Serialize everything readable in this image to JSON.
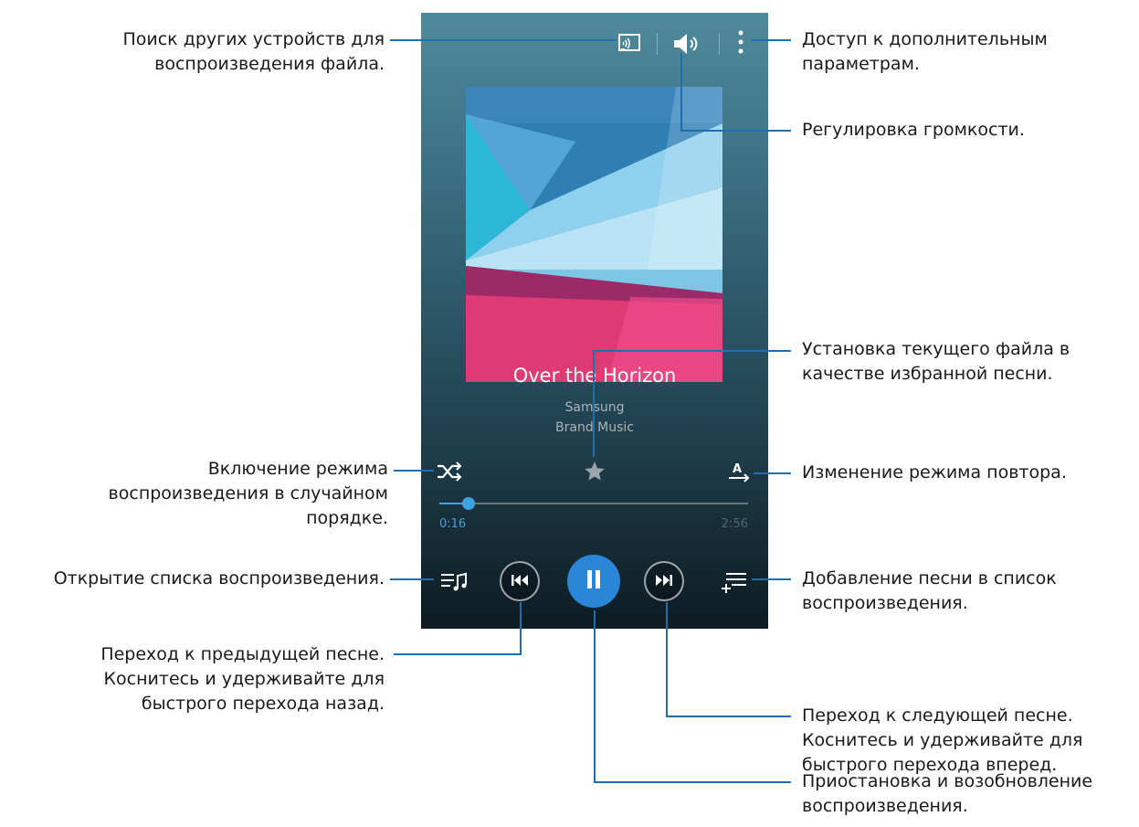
{
  "player": {
    "song_title": "Over the Horizon",
    "artist": "Samsung",
    "album": "Brand Music",
    "time_elapsed": "0:16",
    "time_total": "2:56",
    "progress_fraction": 0.094,
    "accent_color": "#2a86d6",
    "icons": {
      "cast": "screen-mirroring-icon",
      "volume": "volume-icon",
      "more": "more-options-icon",
      "shuffle": "shuffle-icon",
      "favourite": "star-icon",
      "repeat": "repeat-a-icon",
      "playlist": "playlist-icon",
      "previous": "previous-track-icon",
      "pause": "pause-icon",
      "next": "next-track-icon",
      "add_to_playlist": "add-to-playlist-icon"
    }
  },
  "annotations": {
    "search_devices": [
      "Поиск других устройств для",
      "воспроизведения файла."
    ],
    "more_options": [
      "Доступ к дополнительным",
      "параметрам."
    ],
    "volume": [
      "Регулировка громкости."
    ],
    "favourite": [
      "Установка текущего файла в",
      "качестве избранной песни."
    ],
    "shuffle": [
      "Включение режима",
      "воспроизведения в случайном",
      "порядке."
    ],
    "repeat": [
      "Изменение режима повтора."
    ],
    "playlist": [
      "Открытие списка воспроизведения."
    ],
    "add_to_playlist": [
      "Добавление песни в список",
      "воспроизведения."
    ],
    "previous": [
      "Переход к предыдущей песне.",
      "Коснитесь и удерживайте для",
      "быстрого перехода назад."
    ],
    "next": [
      "Переход к следующей песне.",
      "Коснитесь и удерживайте для",
      "быстрого перехода вперед."
    ],
    "pause": [
      "Приостановка и возобновление",
      "воспроизведения."
    ]
  }
}
